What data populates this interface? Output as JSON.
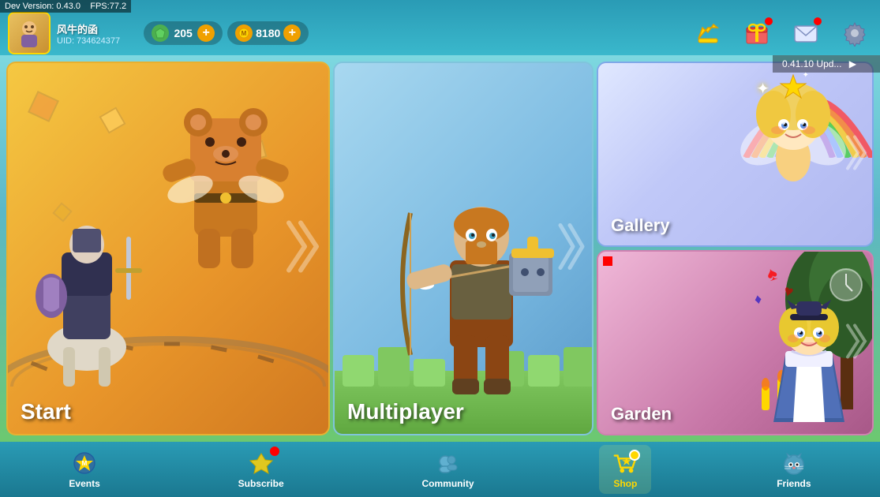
{
  "debug": {
    "version": "Dev Version: 0.43.0",
    "fps": "FPS:77.2"
  },
  "player": {
    "name": "风牛的函",
    "uid_label": "UID: 734624377"
  },
  "currencies": [
    {
      "id": "gems",
      "value": "205",
      "color": "green",
      "symbol": "◆"
    },
    {
      "id": "coins",
      "value": "8180",
      "color": "gold",
      "symbol": "●"
    }
  ],
  "update_text": "0.41.10 Upd...",
  "cards": [
    {
      "id": "start",
      "label": "Start"
    },
    {
      "id": "multiplayer",
      "label": "Multiplayer"
    },
    {
      "id": "gallery",
      "label": "Gallery"
    },
    {
      "id": "garden",
      "label": "Garden"
    }
  ],
  "nav_items": [
    {
      "id": "events",
      "label": "Events",
      "has_badge": false
    },
    {
      "id": "subscribe",
      "label": "Subscribe",
      "has_badge": true
    },
    {
      "id": "community",
      "label": "Community",
      "has_badge": false
    },
    {
      "id": "shop",
      "label": "Shop",
      "has_badge": true
    },
    {
      "id": "friends",
      "label": "Friends",
      "has_badge": false
    }
  ],
  "header_buttons": [
    {
      "id": "ranking",
      "icon": "crown"
    },
    {
      "id": "gifts",
      "icon": "gift",
      "has_badge": true
    },
    {
      "id": "mail",
      "icon": "mail",
      "has_badge": true
    },
    {
      "id": "settings",
      "icon": "gear"
    }
  ]
}
